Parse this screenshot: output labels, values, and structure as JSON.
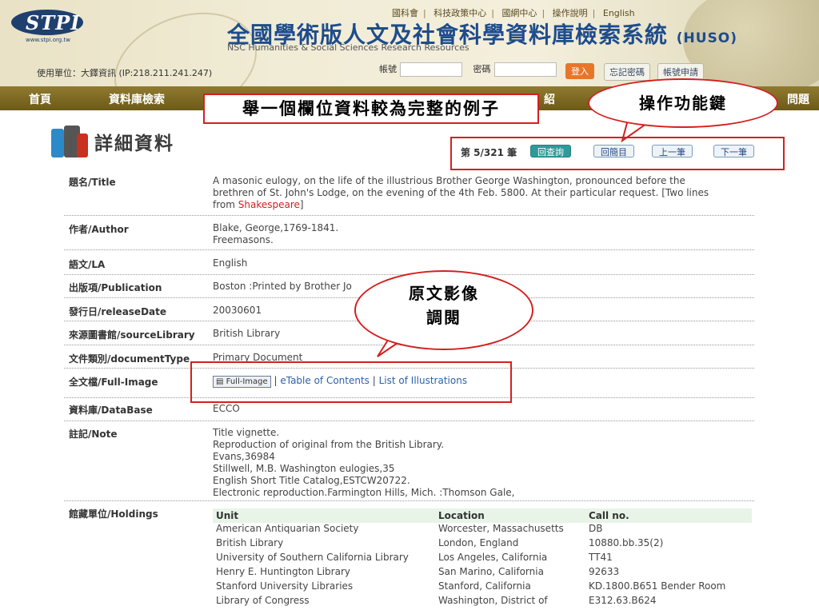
{
  "header": {
    "logo_text": "STPI",
    "logo_url": "www.stpi.org.tw",
    "top_links": [
      "國科會",
      "科技政策中心",
      "國網中心",
      "操作說明",
      "English"
    ],
    "title": "全國學術版人文及社會科學資料庫檢索系統",
    "title_suffix": "(HUSO)",
    "subtitle": "NSC Humanities & Social Sciences Research Resources",
    "unit_info": "使用單位：大鐸資訊 (IP:218.211.241.247)",
    "account_label": "帳號",
    "password_label": "密碼",
    "login_button": "登入",
    "forgot_button": "忘記密碼",
    "apply_button": "帳號申請"
  },
  "nav": {
    "home": "首頁",
    "db_search": "資料庫檢索",
    "partial_intro": "紹",
    "partial_faq": "問題"
  },
  "annotations": {
    "example_note": "舉一個欄位資料較為完整的例子",
    "function_keys": "操作功能鍵",
    "image_line1": "原文影像",
    "image_line2": "調閱"
  },
  "page": {
    "title": "詳細資料",
    "record_position": "第 5/321 筆",
    "btn_back_query": "回查詢",
    "btn_back_brief": "回簡目",
    "btn_prev": "上一筆",
    "btn_next": "下一筆"
  },
  "record": {
    "title_label": "題名/Title",
    "title_line1": "A masonic eulogy, on the life of the illustrious Brother George Washington, pronounced before the",
    "title_line2": "brethren of St. John's Lodge, on the evening of the 4th Feb. 5800. At their particular request. [Two lines",
    "title_line3_pre": "from ",
    "title_line3_red": "Shakespeare",
    "title_line3_post": "]",
    "author_label": "作者/Author",
    "author_line1": "Blake, George,1769-1841.",
    "author_line2": "Freemasons.",
    "lang_label": "語文/LA",
    "lang_value": "English",
    "pub_label": "出版項/Publication",
    "pub_value": "Boston :Printed by Brother Jo",
    "release_label": "發行日/releaseDate",
    "release_value": "20030601",
    "source_label": "來源圖書館/sourceLibrary",
    "source_value": "British Library",
    "doctype_label": "文件類別/documentType",
    "doctype_value": "Primary Document",
    "fullimage_label": "全文檔/Full-Image",
    "fullimage_button": "Full-Image",
    "etoc_link": "eTable of Contents",
    "illus_link": "List of Illustrations",
    "db_label": "資料庫/DataBase",
    "db_value": "ECCO",
    "note_label": "註記/Note",
    "note_lines": [
      "Title vignette.",
      "Reproduction of original from the British Library.",
      "Evans,36984",
      "Stillwell, M.B. Washington eulogies,35",
      "English Short Title Catalog,ESTCW20722.",
      "Electronic reproduction.Farmington Hills, Mich. :Thomson Gale,"
    ],
    "holdings_label": "館藏單位/Holdings"
  },
  "holdings": {
    "headers": [
      "Unit",
      "Location",
      "Call no."
    ],
    "rows": [
      [
        "American Antiquarian Society",
        "Worcester, Massachusetts",
        "DB"
      ],
      [
        "British Library",
        "London, England",
        "10880.bb.35(2)"
      ],
      [
        "University of Southern California Library",
        "Los Angeles, California",
        "TT41"
      ],
      [
        "Henry E. Huntington Library",
        "San Marino, California",
        "92633"
      ],
      [
        "Stanford University Libraries",
        "Stanford, California",
        "KD.1800.B651 Bender Room"
      ],
      [
        "Library of Congress",
        "Washington, District of",
        "E312.63.B624"
      ]
    ]
  },
  "colors": {
    "nav_bg": "#7d6a22",
    "title_blue": "#1e4c8c",
    "callout_red": "#d42020",
    "link_blue": "#2b62a8"
  }
}
